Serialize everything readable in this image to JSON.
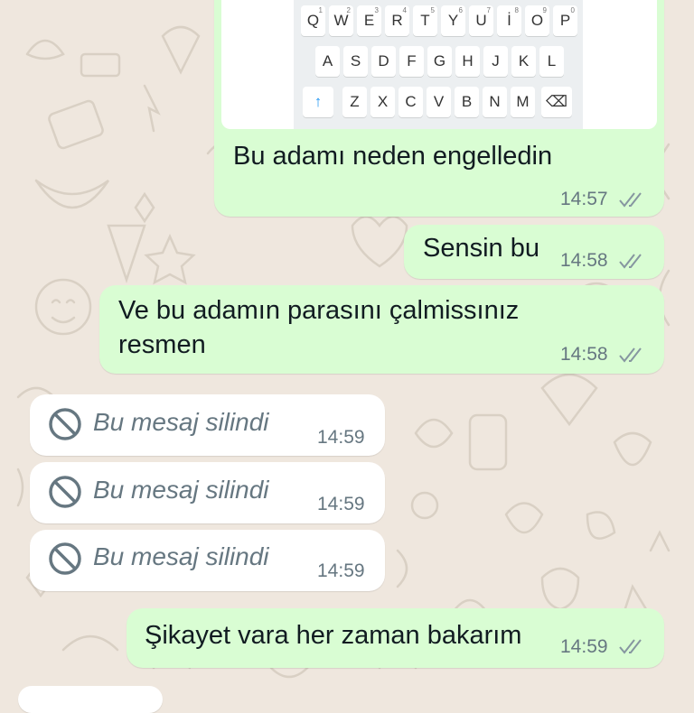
{
  "keyboard": {
    "row1": [
      {
        "k": "Q",
        "n": "1"
      },
      {
        "k": "W",
        "n": "2"
      },
      {
        "k": "E",
        "n": "3"
      },
      {
        "k": "R",
        "n": "4"
      },
      {
        "k": "T",
        "n": "5"
      },
      {
        "k": "Y",
        "n": "6"
      },
      {
        "k": "U",
        "n": "7"
      },
      {
        "k": "İ",
        "n": "8"
      },
      {
        "k": "O",
        "n": "9"
      },
      {
        "k": "P",
        "n": "0"
      }
    ],
    "row2": [
      "A",
      "S",
      "D",
      "F",
      "G",
      "H",
      "J",
      "K",
      "L"
    ],
    "row3": [
      "Z",
      "X",
      "C",
      "V",
      "B",
      "N",
      "M"
    ],
    "shift_icon": "shift-arrow-icon",
    "backspace_icon": "backspace-icon"
  },
  "messages": [
    {
      "id": "m1",
      "type": "outgoing",
      "text": "Bu adamı neden engelledin",
      "time": "14:57",
      "status": "read"
    },
    {
      "id": "m2",
      "type": "outgoing",
      "text": "Sensin bu",
      "time": "14:58",
      "status": "read"
    },
    {
      "id": "m3",
      "type": "outgoing",
      "lines": [
        "Ve bu adamın parasını çalmissınız",
        "resmen"
      ],
      "time": "14:58",
      "status": "read"
    },
    {
      "id": "m4",
      "type": "incoming-deleted",
      "text": "Bu mesaj silindi",
      "time": "14:59"
    },
    {
      "id": "m5",
      "type": "incoming-deleted",
      "text": "Bu mesaj silindi",
      "time": "14:59"
    },
    {
      "id": "m6",
      "type": "incoming-deleted",
      "text": "Bu mesaj silindi",
      "time": "14:59"
    },
    {
      "id": "m7",
      "type": "outgoing",
      "text": "Şikayet vara her zaman bakarım",
      "time": "14:59",
      "status": "read"
    }
  ],
  "colors": {
    "wallpaper": "#efe7de",
    "outgoing_bubble": "#d9fdd3",
    "incoming_bubble": "#ffffff",
    "meta_text": "#667781",
    "tick_gray": "#8696a0"
  }
}
